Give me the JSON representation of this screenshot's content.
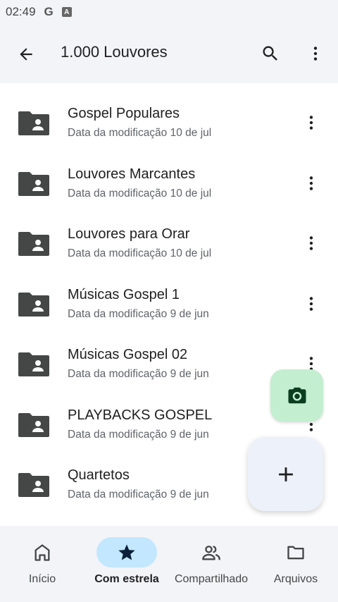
{
  "status_bar": {
    "time": "02:49",
    "g_label": "G",
    "a_label": "A"
  },
  "header": {
    "title": "1.000 Louvores",
    "back_icon": "arrow-back-icon",
    "search_icon": "search-icon",
    "more_icon": "more-vert-icon"
  },
  "files": [
    {
      "name": "Gospel Populares",
      "modified": "Data da modificação 10 de jul"
    },
    {
      "name": "Louvores Marcantes",
      "modified": "Data da modificação 10 de jul"
    },
    {
      "name": "Louvores para Orar",
      "modified": "Data da modificação 10 de jul"
    },
    {
      "name": "Músicas Gospel 1",
      "modified": "Data da modificação 9 de jun"
    },
    {
      "name": "Músicas Gospel 02",
      "modified": "Data da modificação 9 de jun"
    },
    {
      "name": "PLAYBACKS GOSPEL",
      "modified": "Data da modificação 9 de jun"
    },
    {
      "name": "Quartetos",
      "modified": "Data da modificação 9 de jun"
    }
  ],
  "fab": {
    "camera_icon": "camera-icon",
    "add_icon": "plus-icon",
    "camera_color": "#c4eed0",
    "add_color": "#edf1f9"
  },
  "bottom_nav": {
    "items": [
      {
        "label": "Início",
        "icon": "home-icon",
        "active": false
      },
      {
        "label": "Com estrela",
        "icon": "star-icon",
        "active": true
      },
      {
        "label": "Compartilhado",
        "icon": "people-icon",
        "active": false
      },
      {
        "label": "Arquivos",
        "icon": "folder-icon",
        "active": false
      }
    ]
  },
  "colors": {
    "accent": "#c2e7ff",
    "surface": "#f3f4f8",
    "folder": "#444746"
  }
}
